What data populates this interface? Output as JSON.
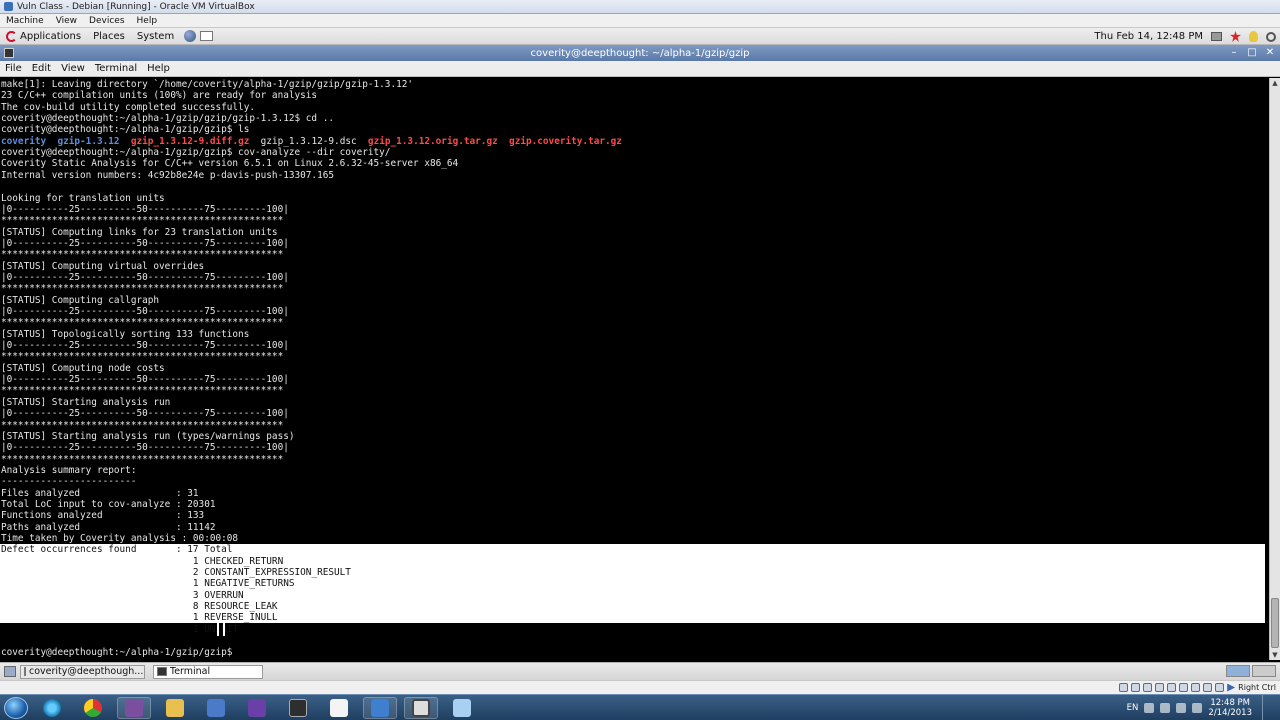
{
  "vbox": {
    "window_title": "Vuln Class - Debian [Running] - Oracle VM VirtualBox",
    "menu": [
      "Machine",
      "View",
      "Devices",
      "Help"
    ],
    "status_right": "Right Ctrl"
  },
  "gnome_panel": {
    "menus": [
      "Applications",
      "Places",
      "System"
    ],
    "clock": "Thu Feb 14, 12:48 PM",
    "icons": [
      "debian-icon",
      "globe-icon",
      "mail-icon",
      "tray-box-icon",
      "red-star-icon",
      "bulb-icon",
      "search-icon"
    ]
  },
  "terminal": {
    "title": "coverity@deepthought: ~/alpha-1/gzip/gzip",
    "menu": [
      "File",
      "Edit",
      "View",
      "Terminal",
      "Help"
    ],
    "lines": [
      "make[1]: Leaving directory `/home/coverity/alpha-1/gzip/gzip/gzip-1.3.12'",
      "23 C/C++ compilation units (100%) are ready for analysis",
      "The cov-build utility completed successfully.",
      "coverity@deepthought:~/alpha-1/gzip/gzip/gzip-1.3.12$ cd ..",
      "coverity@deepthought:~/alpha-1/gzip/gzip$ ls",
      "",
      "coverity@deepthought:~/alpha-1/gzip/gzip$ cov-analyze --dir coverity/",
      "Coverity Static Analysis for C/C++ version 6.5.1 on Linux 2.6.32-45-server x86_64",
      "Internal version numbers: 4c92b8e24e p-davis-push-13307.165",
      "",
      "Looking for translation units",
      "|0----------25----------50----------75---------100|",
      "**************************************************",
      "[STATUS] Computing links for 23 translation units",
      "|0----------25----------50----------75---------100|",
      "**************************************************",
      "[STATUS] Computing virtual overrides",
      "|0----------25----------50----------75---------100|",
      "**************************************************",
      "[STATUS] Computing callgraph",
      "|0----------25----------50----------75---------100|",
      "**************************************************",
      "[STATUS] Topologically sorting 133 functions",
      "|0----------25----------50----------75---------100|",
      "**************************************************",
      "[STATUS] Computing node costs",
      "|0----------25----------50----------75---------100|",
      "**************************************************",
      "[STATUS] Starting analysis run",
      "|0----------25----------50----------75---------100|",
      "**************************************************",
      "[STATUS] Starting analysis run (types/warnings pass)",
      "|0----------25----------50----------75---------100|",
      "**************************************************",
      "Analysis summary report:",
      "------------------------",
      "Files analyzed                 : 31",
      "Total LoC input to cov-analyze : 20301",
      "Functions analyzed             : 133",
      "Paths analyzed                 : 11142",
      "Time taken by Coverity analysis : 00:00:08",
      "Defect occurrences found       : 17 Total",
      "                                  1 CHECKED_RETURN",
      "                                  2 CONSTANT_EXPRESSION_RESULT",
      "                                  1 NEGATIVE_RETURNS",
      "                                  3 OVERRUN",
      "                                  8 RESOURCE_LEAK",
      "                                  1 REVERSE_INULL",
      "                                  1 UNINIT",
      "",
      "coverity@deepthought:~/alpha-1/gzip/gzip$"
    ],
    "ls_entries": [
      {
        "text": "coverity",
        "kind": "dir"
      },
      {
        "text": "gzip-1.3.12",
        "kind": "dir"
      },
      {
        "text": "gzip_1.3.12-9.diff.gz",
        "kind": "archive"
      },
      {
        "text": "gzip_1.3.12-9.dsc",
        "kind": "file"
      },
      {
        "text": "gzip_1.3.12.orig.tar.gz",
        "kind": "archive"
      },
      {
        "text": "gzip.coverity.tar.gz",
        "kind": "archive"
      }
    ],
    "colors": {
      "foreground": "#e6e6e6",
      "dir": "#5e8cd8",
      "archive": "#ff4a4a",
      "selection": "#ffffff"
    }
  },
  "bottom_panel": {
    "tasks": [
      "coverity@deepthough...",
      "Terminal"
    ]
  },
  "win_taskbar": {
    "pinned": [
      "ie-icon",
      "chrome-icon",
      "app-icon",
      "folder-icon",
      "network-icon",
      "visual-studio-icon",
      "x-icon",
      "document-icon",
      "virtualbox-icon",
      "terminal-icon",
      "feather-icon"
    ],
    "lang": "EN",
    "time": "12:48 PM",
    "date": "2/14/2013"
  }
}
